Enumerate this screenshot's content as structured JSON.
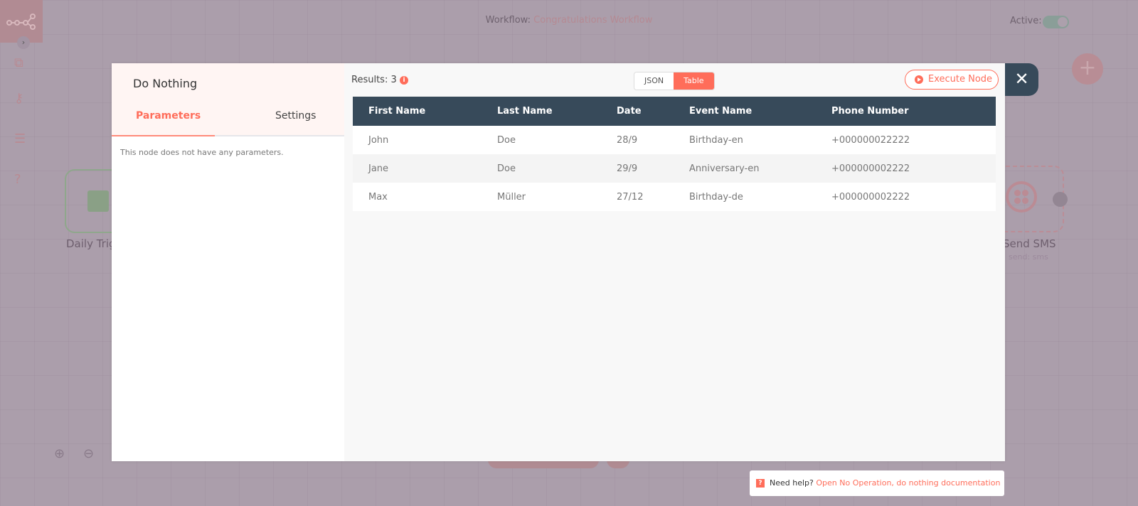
{
  "header": {
    "workflow_label": "Workflow:",
    "workflow_name": "Congratulations Workflow",
    "active_label": "Active:",
    "active": true
  },
  "canvas": {
    "nodes": [
      {
        "label": "Daily Trig"
      },
      {
        "label": "Send SMS",
        "sublabel": "send: sms"
      }
    ]
  },
  "modal": {
    "title": "Do Nothing",
    "tabs": [
      {
        "label": "Parameters",
        "active": true
      },
      {
        "label": "Settings"
      }
    ],
    "no_params": "This node does not have any parameters.",
    "results_label": "Results: 3",
    "view_options": [
      {
        "label": "JSON"
      },
      {
        "label": "Table",
        "active": true
      }
    ],
    "execute_label": "Execute Node",
    "table": {
      "columns": [
        "First Name",
        "Last Name",
        "Date",
        "Event Name",
        "Phone Number"
      ],
      "rows": [
        [
          "John",
          "Doe",
          "28/9",
          "Birthday-en",
          "+000000022222"
        ],
        [
          "Jane",
          "Doe",
          "29/9",
          "Anniversary-en",
          "+000000002222"
        ],
        [
          "Max",
          "Müller",
          "27/12",
          "Birthday-de",
          "+000000002222"
        ]
      ]
    }
  },
  "help": {
    "prefix": "Need help?",
    "link": "Open No Operation, do nothing documentation"
  },
  "colors": {
    "accent": "#ff6d5a",
    "header_dark": "#374a5a",
    "overlay": "#ab9eab"
  }
}
